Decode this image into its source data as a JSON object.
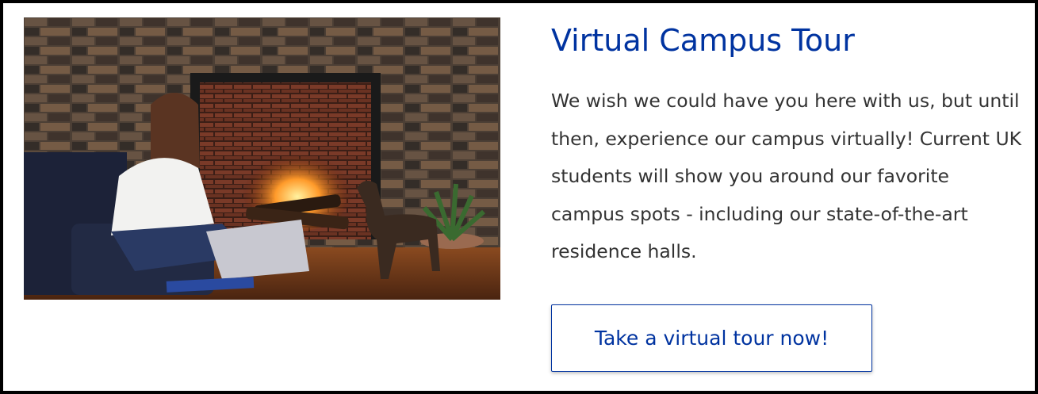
{
  "promo": {
    "title": "Virtual Campus Tour",
    "body": "We wish we could have you here with us, but until then, experience our campus virtually! Current UK students will show you around our favorite campus spots - including our state-of-the-art residence halls.",
    "button_label": "Take a virtual tour now!"
  },
  "colors": {
    "accent": "#0033a0",
    "body_text": "#333333",
    "border": "#000000"
  }
}
